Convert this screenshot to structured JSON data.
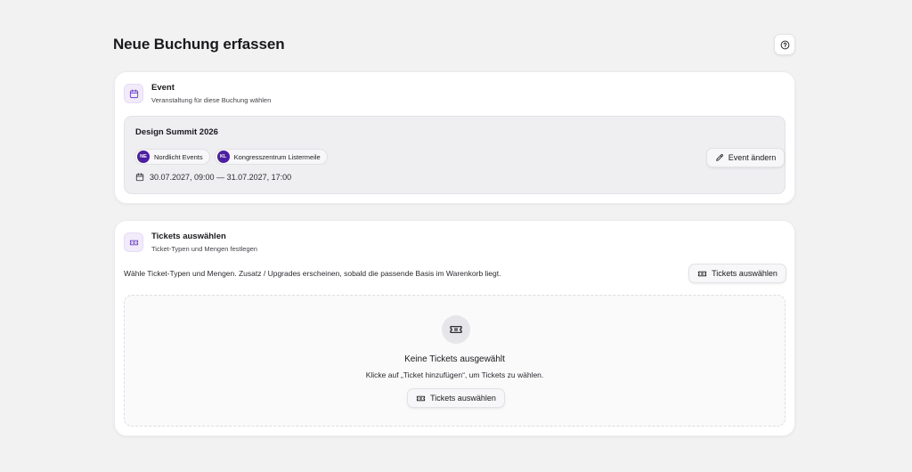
{
  "page": {
    "title": "Neue Buchung erfassen",
    "help_icon": "question-circle-icon"
  },
  "event_section": {
    "icon": "calendar-icon",
    "title": "Event",
    "subtitle": "Veranstaltung für diese Buchung wählen",
    "event": {
      "name": "Design Summit 2026",
      "organizer": {
        "initials": "NE",
        "label": "Nordlicht Events"
      },
      "venue": {
        "initials": "KL",
        "label": "Kongresszentrum Listermeile"
      },
      "date_range": "30.07.2027, 09:00 — 31.07.2027, 17:00"
    },
    "change_button": "Event ändern"
  },
  "tickets_section": {
    "icon": "ticket-icon",
    "title": "Tickets auswählen",
    "subtitle": "Ticket-Typen und Mengen festlegen",
    "hint": "Wähle Ticket-Typen und Mengen. Zusatz / Upgrades erscheinen, sobald die passende Basis im Warenkorb liegt.",
    "select_button": "Tickets auswählen",
    "empty": {
      "title": "Keine Tickets ausgewählt",
      "subtitle": "Klicke auf „Ticket hinzufügen“, um Tickets zu wählen.",
      "button": "Tickets auswählen"
    }
  },
  "colors": {
    "accent": "#4b1fa0",
    "accent_soft": "#f1ebfa",
    "background": "#f2f2f3"
  }
}
